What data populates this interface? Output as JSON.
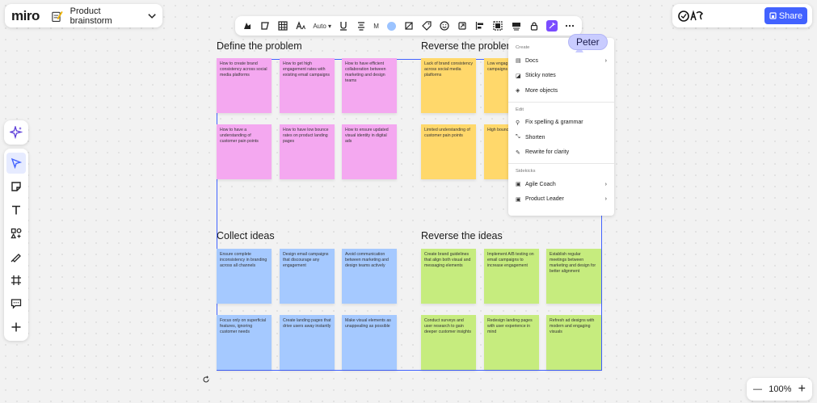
{
  "app": {
    "logo": "miro"
  },
  "board": {
    "title": "Product brainstorm"
  },
  "share": {
    "label": "Share"
  },
  "toolbar": {
    "auto_label": "Auto",
    "font_label": "M"
  },
  "sections": [
    {
      "title": "Define the problem"
    },
    {
      "title": "Reverse the problem"
    },
    {
      "title": "Collect ideas"
    },
    {
      "title": "Reverse the ideas"
    }
  ],
  "notes": {
    "define": [
      "How to create brand consistency across social media platforms",
      "How to get high engagement rates with existing email campaigns",
      "How to have efficient collaboration between marketing and design teams",
      "How to have a understanding of customer pain points",
      "How to have low bounce rates on product landing pages",
      "How to ensure updated visual identity in digital ads"
    ],
    "reverse_problem": [
      "Lack of brand consistency across social media platforms",
      "Low engag with existi campaigns",
      "Limited understanding of customer pain points",
      "High bounc product la"
    ],
    "collect": [
      "Ensure complete inconsistency in branding across all channels",
      "Design email campaigns that discourage any engagement",
      "Avoid communication between marketing and design teams actively",
      "Focus only on superficial features, ignoring customer needs",
      "Create landing pages that drive users away instantly",
      "Make visual elements as unappealing as possible"
    ],
    "reverse_ideas": [
      "Create brand guidelines that align both visual and messaging elements",
      "Implement A/B testing on email campaigns to increase engagement",
      "Establish regular meetings between marketing and design for better alignment",
      "Conduct surveys and user research to gain deeper customer insights",
      "Redesign landing pages with user experience in mind",
      "Refresh ad designs with modern and engaging visuals"
    ]
  },
  "menu": {
    "create_label": "Create",
    "create_items": [
      "Docs",
      "Sticky notes",
      "More objects"
    ],
    "edit_label": "Edit",
    "edit_items": [
      "Fix spelling & grammar",
      "Shorten",
      "Rewrite for clarity"
    ],
    "sidekicks_label": "Sidekicks",
    "sidekick_items": [
      "Agile Coach",
      "Product Leader"
    ]
  },
  "cursor": {
    "name": "Peter"
  },
  "zoom": {
    "level": "100%",
    "minus": "—",
    "plus": "+"
  },
  "colors": {
    "accent": "#4262ff",
    "pink_note": "#f4a8f0",
    "yellow_note": "#ffd86b",
    "blue_note": "#a5c9ff",
    "green_note": "#c6ec7e"
  }
}
